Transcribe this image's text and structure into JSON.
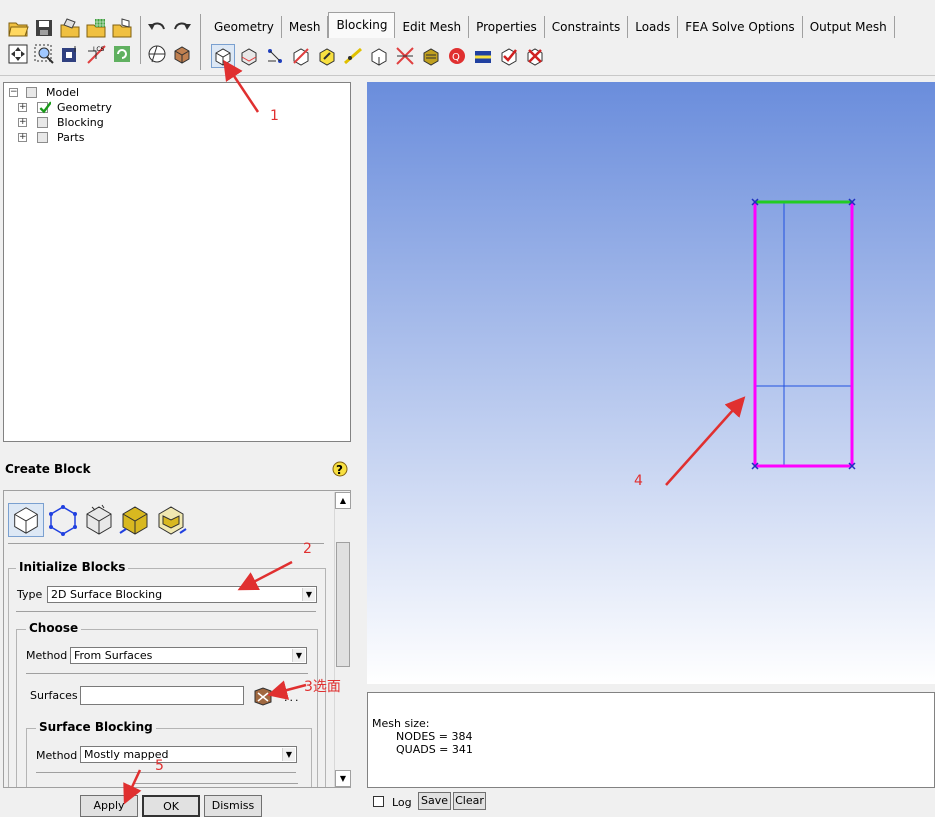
{
  "toolbar": {
    "left_icons": [
      "open-project-icon",
      "save-project-icon",
      "open-geometry-icon",
      "open-mesh-icon",
      "open-blocking-icon",
      "undo-icon",
      "redo-icon",
      "fit-window-icon",
      "zoom-box-icon",
      "view-icon",
      "measure-icon",
      "refresh-icon",
      "solid-display-icon",
      "wireframe-display-icon"
    ],
    "tabs": [
      "Geometry",
      "Mesh",
      "Blocking",
      "Edit Mesh",
      "Properties",
      "Constraints",
      "Loads",
      "FEA Solve Options",
      "Output Mesh"
    ],
    "active_tab": "Blocking",
    "blocking_icons": [
      "create-block-icon",
      "split-block-icon",
      "merge-vertices-icon",
      "edit-block-icon",
      "associate-icon",
      "move-vertex-icon",
      "transform-blocks-icon",
      "edit-edge-icon",
      "pre-mesh-params-icon",
      "pre-mesh-quality-icon",
      "pre-mesh-smooth-icon",
      "check-blocks-icon",
      "delete-block-icon"
    ]
  },
  "tree": {
    "items": [
      {
        "label": "Model",
        "level": 0
      },
      {
        "label": "Geometry",
        "level": 1,
        "checked": true
      },
      {
        "label": "Blocking",
        "level": 1,
        "checked": false
      },
      {
        "label": "Parts",
        "level": 1,
        "checked": false
      }
    ]
  },
  "panel": {
    "title": "Create Block",
    "init_group": "Initialize Blocks",
    "type_label": "Type",
    "type_value": "2D Surface Blocking",
    "choose_group": "Choose",
    "method_label": "Method",
    "method_value": "From Surfaces",
    "surfaces_label": "Surfaces",
    "surfaces_value": "",
    "surfaces_more": "...",
    "surface_blocking_group": "Surface Blocking",
    "sb_method_label": "Method",
    "sb_method_value": "Mostly mapped",
    "apply": "Apply",
    "ok": "OK",
    "dismiss": "Dismiss"
  },
  "messages": {
    "line1": "Mesh size:",
    "line2": "NODES = 384",
    "line3": "QUADS = 341",
    "log": "Log",
    "save": "Save",
    "clear": "Clear"
  },
  "annotations": {
    "a1": "1",
    "a2": "2",
    "a3": "3选面",
    "a4": "4",
    "a5": "5"
  },
  "colors": {
    "annotation": "#e03030",
    "edge_magenta": "#ff00ff",
    "edge_green": "#22cc22",
    "internal_blue": "#2050e0"
  }
}
